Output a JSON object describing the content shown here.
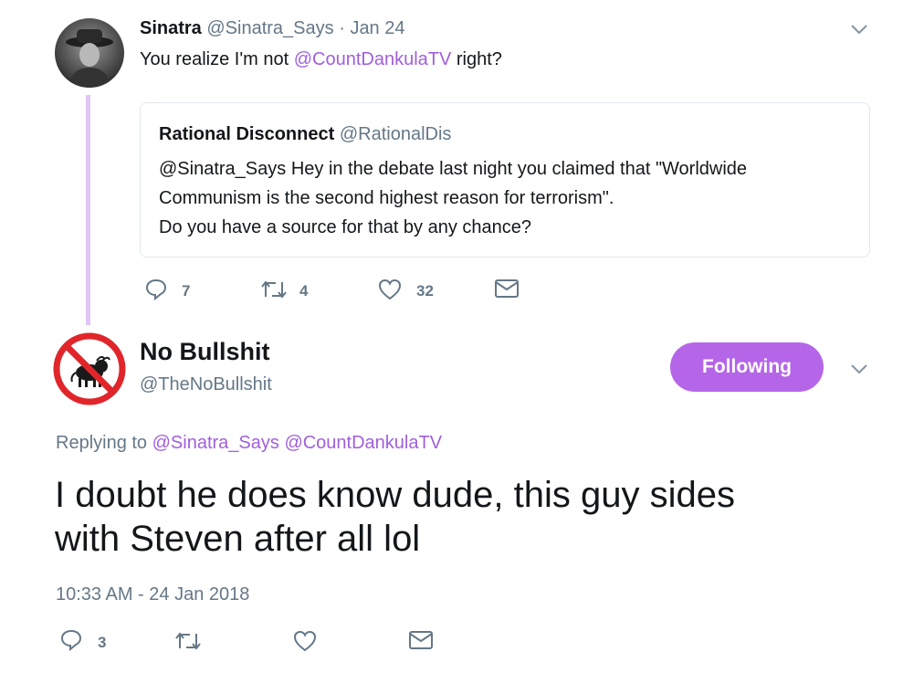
{
  "parent_tweet": {
    "author_name": "Sinatra",
    "author_handle": "@Sinatra_Says",
    "separator": "·",
    "date": "Jan 24",
    "text_before": "You realize I'm not ",
    "mention": "@CountDankulaTV",
    "text_after": " right?",
    "quoted": {
      "author_name": "Rational Disconnect",
      "author_handle": "@RationalDis",
      "line1": "@Sinatra_Says Hey in the debate last night you claimed that \"Worldwide",
      "line2": "Communism is the second highest reason for terrorism\".",
      "line3": "Do you have a source for that by any chance?"
    },
    "actions": {
      "replies": "7",
      "retweets": "4",
      "likes": "32"
    }
  },
  "main_tweet": {
    "author_name": "No Bullshit",
    "author_handle": "@TheNoBullshit",
    "follow_label": "Following",
    "replying_prefix": "Replying to ",
    "replying_handles": "@Sinatra_Says @CountDankulaTV",
    "text_line1": "I doubt he does know dude, this guy sides",
    "text_line2": "with Steven after all lol",
    "timestamp": "10:33 AM - 24 Jan 2018",
    "actions": {
      "replies": "3"
    }
  },
  "icons": {
    "caret": "chevron-down-icon",
    "reply": "reply-icon",
    "retweet": "retweet-icon",
    "like": "heart-icon",
    "dm": "envelope-icon"
  },
  "colors": {
    "accent": "#a05fdc",
    "follow_button": "#b566e8",
    "thread_line": "#e1c6f5",
    "muted": "#657786",
    "no_sign_red": "#e0262b"
  }
}
